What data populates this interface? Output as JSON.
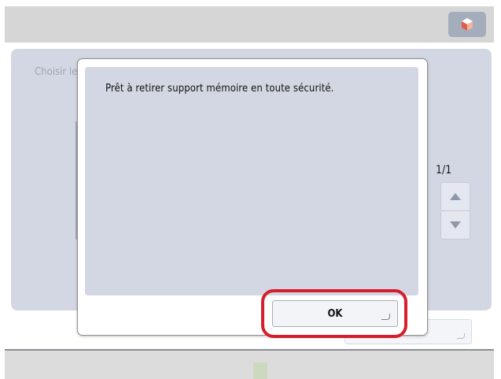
{
  "header": {
    "icon": "cube-icon"
  },
  "background_screen": {
    "title": "Choisir le",
    "page_counter": "1/1",
    "scroll_up_icon": "triangle-up-icon",
    "scroll_down_icon": "triangle-down-icon"
  },
  "dialog": {
    "message": "Prêt à retirer support mémoire en toute sécurité.",
    "ok_label": "OK",
    "ok_icon": "enter-icon"
  },
  "colors": {
    "panel": "#d3d7e3",
    "highlight": "#d61f2c",
    "header_button": "#a3adbb"
  }
}
